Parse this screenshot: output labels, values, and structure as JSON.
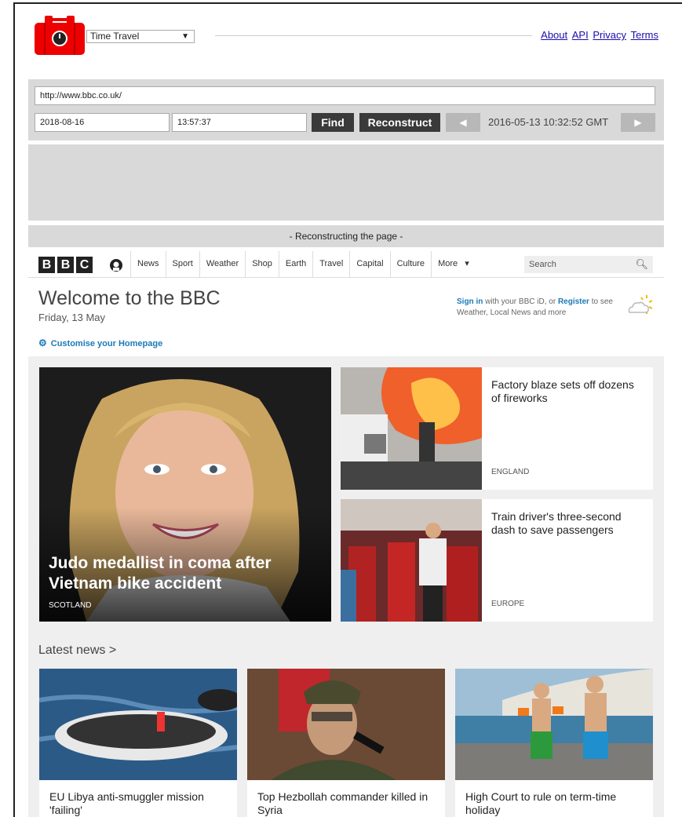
{
  "toolbar": {
    "mode_select": "Time Travel",
    "links": [
      "About",
      "API",
      "Privacy",
      "Terms"
    ]
  },
  "controls": {
    "url": "http://www.bbc.co.uk/",
    "date": "2018-08-16",
    "time": "13:57:37",
    "find_label": "Find",
    "reconstruct_label": "Reconstruct",
    "prev_label": "◀",
    "next_label": "▶",
    "memento_datetime": "2016-05-13 10:32:52 GMT",
    "status": "- Reconstructing the page -"
  },
  "bbc": {
    "nav": [
      "News",
      "Sport",
      "Weather",
      "Shop",
      "Earth",
      "Travel",
      "Capital",
      "Culture",
      "More"
    ],
    "search_placeholder": "Search",
    "welcome": "Welcome to the BBC",
    "date": "Friday, 13 May",
    "signin_link": "Sign in",
    "signin_mid": " with your BBC iD, or ",
    "register_link": "Register",
    "signin_tail": " to see Weather, Local News and more",
    "customise": "Customise your Homepage",
    "hero": {
      "title": "Judo medallist in coma after Vietnam bike accident",
      "tag": "SCOTLAND"
    },
    "stories": [
      {
        "title": "Factory blaze sets off dozens of fireworks",
        "tag": "ENGLAND"
      },
      {
        "title": "Train driver's three-second dash to save passengers",
        "tag": "EUROPE"
      }
    ],
    "latest_label": "Latest news >",
    "latest": [
      {
        "title": "EU Libya anti-smuggler mission 'failing'"
      },
      {
        "title": "Top Hezbollah commander killed in Syria"
      },
      {
        "title": "High Court to rule on term-time holiday"
      }
    ]
  }
}
